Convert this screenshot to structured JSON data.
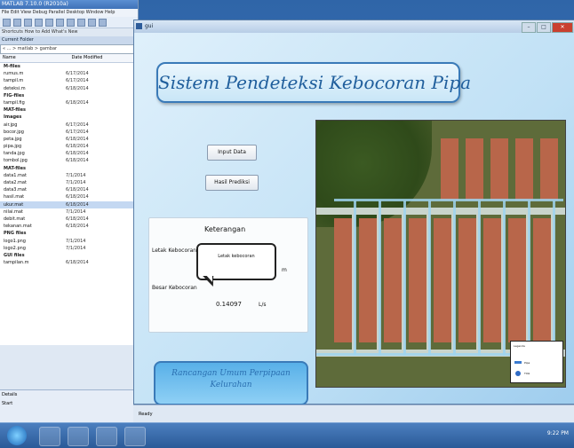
{
  "ide": {
    "title": "MATLAB 7.10.0 (R2010a)",
    "menu": "File  Edit  View  Debug  Parallel  Desktop  Window  Help",
    "path": "Shortcuts  How to Add  What's New",
    "panel": "Current Folder",
    "address": "« ... > matlab > gambar",
    "col_name": "Name",
    "col_date": "Date Modified",
    "files": [
      {
        "n": "M-files",
        "d": "",
        "group": true
      },
      {
        "n": "rumus.m",
        "d": "6/17/2014"
      },
      {
        "n": "tampil.m",
        "d": "6/17/2014"
      },
      {
        "n": "deteksi.m",
        "d": "6/18/2014"
      },
      {
        "n": "FIG-files",
        "d": "",
        "group": true
      },
      {
        "n": "tampil.fig",
        "d": "6/18/2014"
      },
      {
        "n": "MAT-files",
        "d": "",
        "group": true
      },
      {
        "n": "Images",
        "d": "",
        "group": true
      },
      {
        "n": "air.jpg",
        "d": "6/17/2014"
      },
      {
        "n": "bocor.jpg",
        "d": "6/17/2014"
      },
      {
        "n": "peta.jpg",
        "d": "6/18/2014"
      },
      {
        "n": "pipa.jpg",
        "d": "6/18/2014"
      },
      {
        "n": "tanda.jpg",
        "d": "6/18/2014"
      },
      {
        "n": "tombol.jpg",
        "d": "6/18/2014"
      },
      {
        "n": "MAT-files",
        "d": "",
        "group": true
      },
      {
        "n": "data1.mat",
        "d": "7/1/2014"
      },
      {
        "n": "data2.mat",
        "d": "7/1/2014"
      },
      {
        "n": "data3.mat",
        "d": "6/18/2014"
      },
      {
        "n": "hasil.mat",
        "d": "6/18/2014"
      },
      {
        "n": "ukur.mat",
        "d": "6/18/2014",
        "sel": true
      },
      {
        "n": "nilai.mat",
        "d": "7/1/2014"
      },
      {
        "n": "debit.mat",
        "d": "6/18/2014"
      },
      {
        "n": "tekanan.mat",
        "d": "6/18/2014"
      },
      {
        "n": "PNG files",
        "d": "",
        "group": true
      },
      {
        "n": "logo1.png",
        "d": "7/1/2014"
      },
      {
        "n": "logo2.png",
        "d": "7/1/2014"
      },
      {
        "n": "GUI files",
        "d": "",
        "group": true
      },
      {
        "n": "tampilan.m",
        "d": "6/18/2014"
      }
    ],
    "details": "Details",
    "workspace": "Start"
  },
  "form": {
    "title": "gui",
    "title_text": "Sistem Pendeteksi Kebocoran Pipa",
    "btn_input": "Input Data",
    "btn_proses": "Hasil Prediksi",
    "ket_title": "Keterangan",
    "label_letak": "Letak Kebocoran",
    "label_unit_m": "m",
    "label_besar": "Besar Kebocoran",
    "value_besar": "0.14097",
    "unit_besar": "L/s",
    "callout": "Letak kebocoran",
    "bottom_text": "Rancangan Umum Perpipaan Kelurahan",
    "legend_title": "Legenda",
    "legend_pipe": "Pipa",
    "legend_node": "Titik",
    "status": "Ready"
  },
  "taskbar": {
    "tray_time": "9:22 PM"
  }
}
